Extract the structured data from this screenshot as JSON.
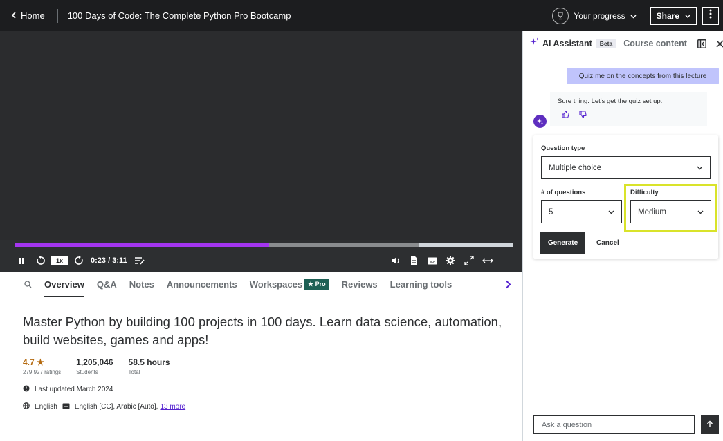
{
  "header": {
    "home_label": "Home",
    "course_title": "100 Days of Code: The Complete Python Pro Bootcamp",
    "progress_label": "Your progress",
    "share_label": "Share"
  },
  "player": {
    "speed": "1x",
    "time": "0:23 / 3:11",
    "played_fraction": 0.51,
    "buffered_fraction": 0.81
  },
  "tabs": {
    "overview": "Overview",
    "qa": "Q&A",
    "notes": "Notes",
    "announcements": "Announcements",
    "workspaces": "Workspaces",
    "pro_badge": "★ Pro",
    "reviews": "Reviews",
    "learning_tools": "Learning tools"
  },
  "course": {
    "headline": "Master Python by building 100 projects in 100 days. Learn data science, automation, build websites, games and apps!",
    "rating": "4.7 ★",
    "ratings_count": "279,927 ratings",
    "students": "1,205,046",
    "students_label": "Students",
    "hours": "58.5 hours",
    "hours_label": "Total",
    "last_updated": "Last updated March 2024",
    "language": "English",
    "captions": "English [CC], Arabic [Auto],",
    "more_link": "13 more"
  },
  "assistant": {
    "title": "AI Assistant",
    "beta": "Beta",
    "course_content_tab": "Course content",
    "user_message": "Quiz me on the concepts from this lecture",
    "ai_message": "Sure thing. Let's get the quiz set up.",
    "quiz": {
      "question_type_label": "Question type",
      "question_type_value": "Multiple choice",
      "num_questions_label": "# of questions",
      "num_questions_value": "5",
      "difficulty_label": "Difficulty",
      "difficulty_value": "Medium",
      "generate_label": "Generate",
      "cancel_label": "Cancel"
    },
    "ask_placeholder": "Ask a question"
  },
  "colors": {
    "accent_purple": "#a435f0",
    "highlight_yellow": "#d9e32a",
    "pro_green": "#1e6055",
    "dark": "#1c1d1f"
  }
}
